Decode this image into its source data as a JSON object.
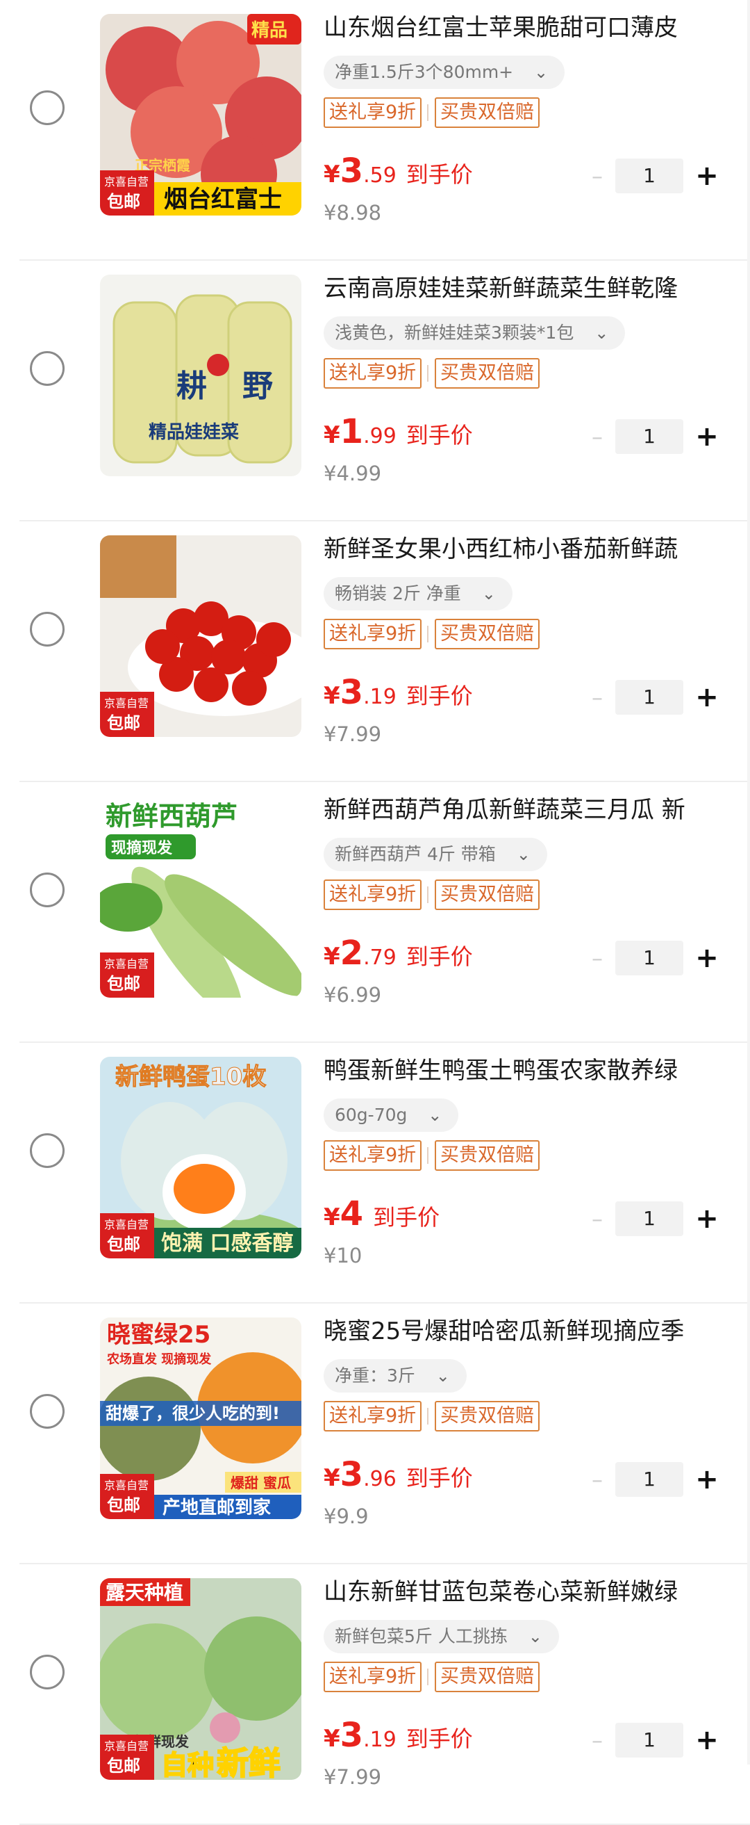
{
  "cart": {
    "items": [
      {
        "title": "山东烟台红富士苹果脆甜可口薄皮",
        "spec": "净重1.5斤3个80mm+",
        "tags": [
          "送礼享9折",
          "买贵双倍赔"
        ],
        "price_currency": "¥",
        "price_int": "3",
        "price_dec": ".59",
        "price_label": "到手价",
        "orig_price": "¥8.98",
        "quantity": "1",
        "image": {
          "badge_top": "精品",
          "badge_top2": "正宗栖霞",
          "jd_line1": "京喜自营",
          "jd_line2": "包邮",
          "caption": "烟台红富士",
          "bg": "#e9e1d8",
          "fruit": "#d94a4a"
        }
      },
      {
        "title": "云南高原娃娃菜新鲜蔬菜生鲜乾隆",
        "spec": "浅黄色，新鲜娃娃菜3颗装*1包",
        "tags": [
          "送礼享9折",
          "买贵双倍赔"
        ],
        "price_currency": "¥",
        "price_int": "1",
        "price_dec": ".99",
        "price_label": "到手价",
        "orig_price": "¥4.99",
        "quantity": "1",
        "image": {
          "word1": "耕",
          "word2": "野",
          "caption": "精品娃娃菜",
          "bg": "#f3f3ef",
          "fruit": "#e6e29a"
        }
      },
      {
        "title": "新鲜圣女果小西红柿小番茄新鲜蔬",
        "spec": "畅销装 2斤 净重",
        "tags": [
          "送礼享9折",
          "买贵双倍赔"
        ],
        "price_currency": "¥",
        "price_int": "3",
        "price_dec": ".19",
        "price_label": "到手价",
        "orig_price": "¥7.99",
        "quantity": "1",
        "image": {
          "jd_line1": "京喜自营",
          "jd_line2": "包邮",
          "bg": "#f1eee9",
          "fruit": "#d41d12"
        }
      },
      {
        "title": "新鲜西葫芦角瓜新鲜蔬菜三月瓜 新",
        "spec": "新鲜西葫芦 4斤 带箱",
        "tags": [
          "送礼享9折",
          "买贵双倍赔"
        ],
        "price_currency": "¥",
        "price_int": "2",
        "price_dec": ".79",
        "price_label": "到手价",
        "orig_price": "¥6.99",
        "quantity": "1",
        "image": {
          "headline": "新鲜西葫芦",
          "sub": "现摘现发",
          "jd_line1": "京喜自营",
          "jd_line2": "包邮",
          "bg": "#ffffff",
          "fruit": "#a9cf7a"
        }
      },
      {
        "title": "鸭蛋新鲜生鸭蛋土鸭蛋农家散养绿",
        "spec": "60g-70g",
        "tags": [
          "送礼享9折",
          "买贵双倍赔"
        ],
        "price_currency": "¥",
        "price_int": "4",
        "price_dec": "",
        "price_label": "到手价",
        "orig_price": "¥10",
        "quantity": "1",
        "image": {
          "headline": "新鲜鸭蛋10枚",
          "caption": "饱满 口感香醇",
          "jd_line1": "京喜自营",
          "jd_line2": "包邮",
          "bg": "#cfe6ef",
          "fruit": "#cfe3e3"
        }
      },
      {
        "title": "晓蜜25号爆甜哈密瓜新鲜现摘应季",
        "spec": "净重：3斤",
        "tags": [
          "送礼享9折",
          "买贵双倍赔"
        ],
        "price_currency": "¥",
        "price_int": "3",
        "price_dec": ".96",
        "price_label": "到手价",
        "orig_price": "¥9.9",
        "quantity": "1",
        "image": {
          "headline": "晓蜜绿25",
          "sub": "农场直发 现摘现发",
          "banner": "甜爆了，很少人吃的到!",
          "tag": "爆甜 蜜瓜",
          "caption": "产地直邮到家",
          "jd_line1": "京喜自营",
          "jd_line2": "包邮",
          "bg": "#f6f3ec",
          "fruit": "#f0922b"
        }
      },
      {
        "title": "山东新鲜甘蓝包菜卷心菜新鲜嫩绿",
        "spec": "新鲜包菜5斤 人工挑拣",
        "tags": [
          "送礼享9折",
          "买贵双倍赔"
        ],
        "price_currency": "¥",
        "price_int": "3",
        "price_dec": ".19",
        "price_label": "到手价",
        "orig_price": "¥7.99",
        "quantity": "1",
        "image": {
          "headline": "露天种植",
          "sub": "新鲜现发",
          "word1": "自种",
          "word2": "新鲜",
          "jd_line1": "京喜自营",
          "jd_line2": "包邮",
          "bg": "#c7d8c0",
          "fruit": "#9dc57b"
        }
      }
    ],
    "accent_color": "#e8231c",
    "tag_color": "#d9672a"
  }
}
